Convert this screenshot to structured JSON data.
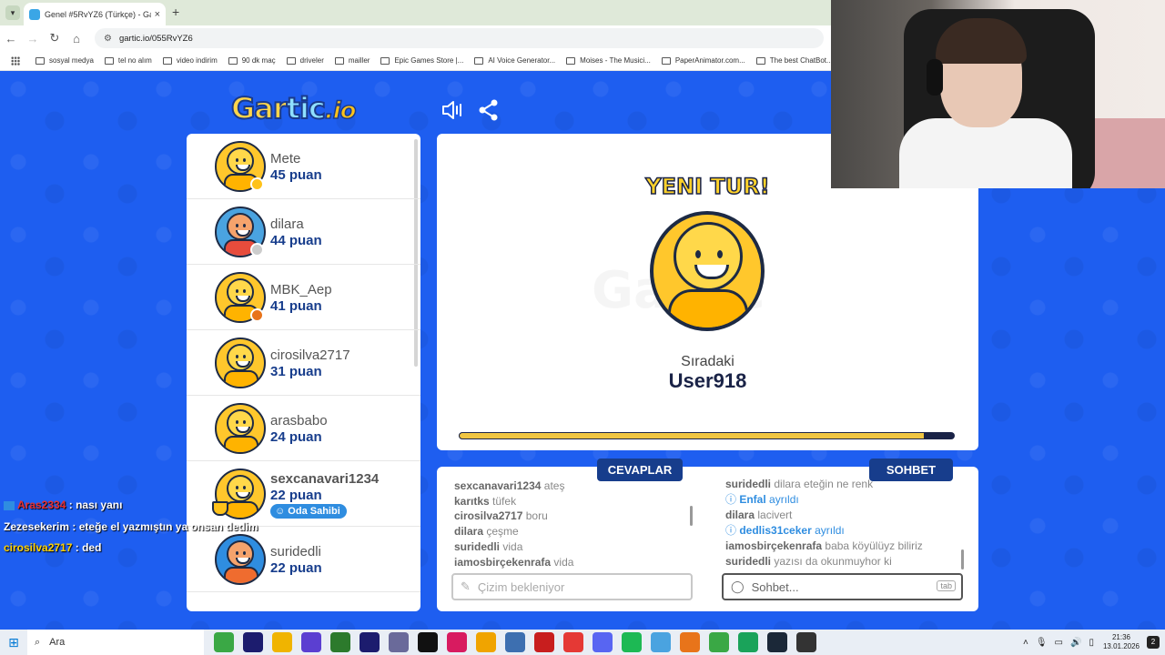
{
  "browser": {
    "tab_title": "Genel #5RvYZ6 (Türkçe) - Gartic",
    "tab_close": "×",
    "new_tab": "+",
    "url": "gartic.io/055RvYZ6",
    "bookmarks": [
      {
        "label": "sosyal medya"
      },
      {
        "label": "tel no alım"
      },
      {
        "label": "video indirim"
      },
      {
        "label": "90 dk maç"
      },
      {
        "label": "driveler"
      },
      {
        "label": "mailler"
      },
      {
        "label": "Epic Games Store |..."
      },
      {
        "label": "AI Voice Generator..."
      },
      {
        "label": "Moises - The Musici..."
      },
      {
        "label": "PaperAnimator.com..."
      },
      {
        "label": "The best ChatBot..."
      }
    ]
  },
  "game": {
    "logo_part1": "Gar",
    "logo_part2": "tic",
    "logo_io": ".io",
    "players": [
      {
        "name": "Mete",
        "score": "45 puan",
        "dot_color": "#ffc21a",
        "avatar": "yellow"
      },
      {
        "name": "dilara",
        "score": "44 puan",
        "dot_color": "#cccccc",
        "avatar": "red"
      },
      {
        "name": "MBK_Aep",
        "score": "41 puan",
        "dot_color": "#e8741a",
        "avatar": "yellow"
      },
      {
        "name": "cirosilva2717",
        "score": "31 puan",
        "dot_color": "",
        "avatar": "yellow"
      },
      {
        "name": "arasbabo",
        "score": "24 puan",
        "dot_color": "",
        "avatar": "yellow"
      },
      {
        "name": "sexcanavari1234",
        "score": "22 puan",
        "dot_color": "",
        "avatar": "yellow",
        "owner_badge": "Oda Sahibi"
      },
      {
        "name": "suridedli",
        "score": "22 puan",
        "dot_color": "",
        "avatar": "blue"
      }
    ],
    "round_title": "YENI TUR!",
    "next_label": "Sıradaki",
    "next_user": "User918",
    "round_progress": 0.94,
    "answers_tab": "CEVAPLAR",
    "chat_tab": "SOHBET",
    "answers": [
      {
        "name": "sexcanavari1234",
        "text": "ateş"
      },
      {
        "name": "karıtks",
        "text": "tüfek"
      },
      {
        "name": "cirosilva2717",
        "text": "boru"
      },
      {
        "name": "dilara",
        "text": "çeşme"
      },
      {
        "name": "suridedli",
        "text": "vida"
      },
      {
        "name": "iamosbirçekenrafa",
        "text": "vida"
      }
    ],
    "chat": [
      {
        "name": "suridedli",
        "text": "dilara eteğin ne renk",
        "system": false
      },
      {
        "name": "Enfal",
        "text": "ayrıldı",
        "system": true
      },
      {
        "name": "dilara",
        "text": "lacivert",
        "system": false
      },
      {
        "name": "dedlis31ceker",
        "text": "ayrıldı",
        "system": true
      },
      {
        "name": "iamosbirçekenrafa",
        "text": "baba köyülüyz biliriz",
        "system": false
      },
      {
        "name": "suridedli",
        "text": "yazısı da okunmuyhor ki",
        "system": false
      }
    ],
    "answer_placeholder": "Çizim bekleniyor",
    "chat_placeholder": "Sohbet...",
    "tab_key": "tab"
  },
  "stream_chat": [
    {
      "user": "Aras2334",
      "text": ": nası yanı",
      "color": "#e83030"
    },
    {
      "user": "Zezesekerim",
      "text": ": eteğe el yazmıştın ya onsan dedim",
      "color": "#ffffff"
    },
    {
      "user": "cirosilva2717",
      "text": ": ded",
      "color": "#ffd100"
    }
  ],
  "taskbar": {
    "search_label": "Ara",
    "time": "21:36",
    "date": "13.01.2026",
    "notif_count": "2",
    "app_colors": [
      "#3aa845",
      "#1c1c6e",
      "#f0b400",
      "#5b3fd1",
      "#2c7a2c",
      "#1c1c6e",
      "#6a6a9a",
      "#111111",
      "#d81b60",
      "#f0a400",
      "#3d6fb0",
      "#c81e1e",
      "#e53935",
      "#5865f2",
      "#1db954",
      "#4aa3e0",
      "#e8741a",
      "#3aa845",
      "#1aa35a",
      "#1b2838",
      "#333333"
    ]
  }
}
